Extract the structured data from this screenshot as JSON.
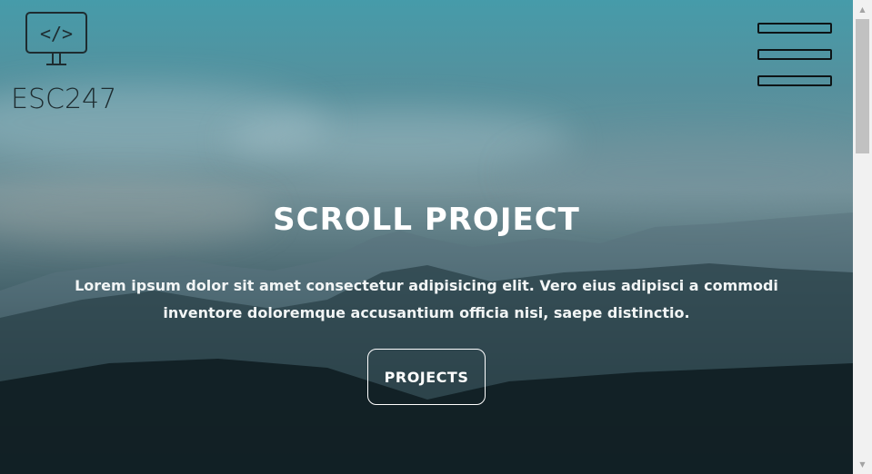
{
  "brand": {
    "logo_text": "ESC247",
    "logo_icon": "monitor-code-icon",
    "monitor_code_glyph": "</>"
  },
  "nav": {
    "menu_icon": "hamburger-menu-icon"
  },
  "hero": {
    "title": "SCROLL PROJECT",
    "text": "Lorem ipsum dolor sit amet consectetur adipisicing elit. Vero eius adipisci a commodi inventore doloremque accusantium officia nisi, saepe distinctio.",
    "button_label": "PROJECTS"
  },
  "scrollbar": {
    "up_icon": "scroll-up-arrow-icon",
    "down_icon": "scroll-down-arrow-icon",
    "up_glyph": "▲",
    "down_glyph": "▼"
  },
  "colors": {
    "sky_top": "#3c96a5",
    "ground": "#081012",
    "text": "#ffffff",
    "logo": "#1e2c30"
  }
}
